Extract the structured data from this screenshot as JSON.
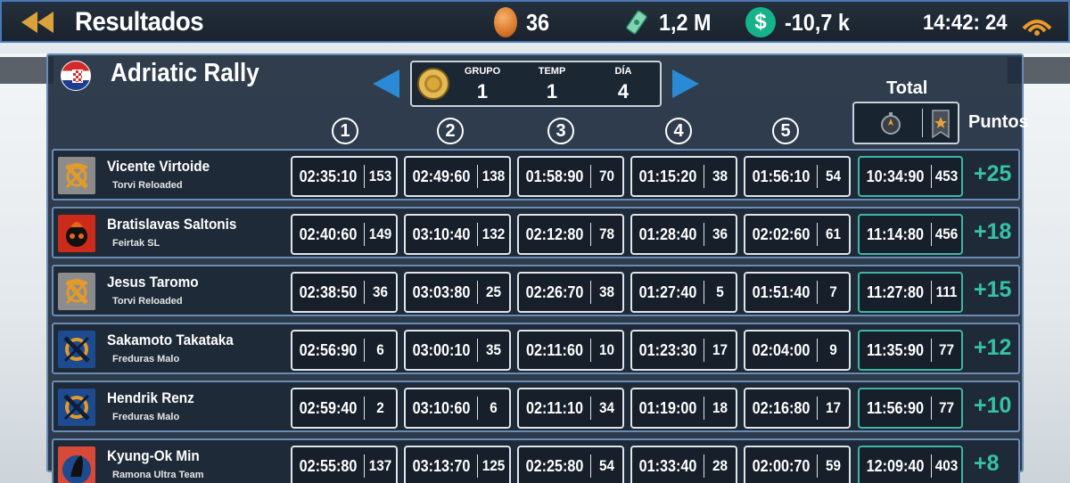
{
  "header": {
    "title": "Resultados",
    "coins": "36",
    "cash": "1,2 M",
    "balance": "-10,7 k",
    "clock": "14:42: 24",
    "colors": {
      "accent": "#4a78b8",
      "points": "#36c2a6"
    }
  },
  "event": {
    "name": "Adriatic Rally",
    "country_flag": "croatia-flag-icon",
    "info": [
      {
        "label": "GRUPO",
        "value": "1"
      },
      {
        "label": "TEMP",
        "value": "1"
      },
      {
        "label": "DÍA",
        "value": "4"
      }
    ]
  },
  "columns": {
    "stages": [
      "1",
      "2",
      "3",
      "4",
      "5"
    ],
    "total_label": "Total",
    "points_label": "Puntos"
  },
  "rows": [
    {
      "driver": "Vicente Virtoide",
      "team": "Torvi Reloaded",
      "avatar": "torvi",
      "stages": [
        [
          "02:35:10",
          "153"
        ],
        [
          "02:49:60",
          "138"
        ],
        [
          "01:58:90",
          "70"
        ],
        [
          "01:15:20",
          "38"
        ],
        [
          "01:56:10",
          "54"
        ]
      ],
      "total": [
        "10:34:90",
        "453"
      ],
      "points": "+25"
    },
    {
      "driver": "Bratislavas Saltonis",
      "team": "Feirtak SL",
      "avatar": "feirtak",
      "stages": [
        [
          "02:40:60",
          "149"
        ],
        [
          "03:10:40",
          "132"
        ],
        [
          "02:12:80",
          "78"
        ],
        [
          "01:28:40",
          "36"
        ],
        [
          "02:02:60",
          "61"
        ]
      ],
      "total": [
        "11:14:80",
        "456"
      ],
      "points": "+18"
    },
    {
      "driver": "Jesus Taromo",
      "team": "Torvi Reloaded",
      "avatar": "torvi",
      "stages": [
        [
          "02:38:50",
          "36"
        ],
        [
          "03:03:80",
          "25"
        ],
        [
          "02:26:70",
          "38"
        ],
        [
          "01:27:40",
          "5"
        ],
        [
          "01:51:40",
          "7"
        ]
      ],
      "total": [
        "11:27:80",
        "111"
      ],
      "points": "+15"
    },
    {
      "driver": "Sakamoto Takataka",
      "team": "Freduras Malo",
      "avatar": "freduras",
      "stages": [
        [
          "02:56:90",
          "6"
        ],
        [
          "03:00:10",
          "35"
        ],
        [
          "02:11:60",
          "10"
        ],
        [
          "01:23:30",
          "17"
        ],
        [
          "02:04:00",
          "9"
        ]
      ],
      "total": [
        "11:35:90",
        "77"
      ],
      "points": "+12"
    },
    {
      "driver": "Hendrik Renz",
      "team": "Freduras Malo",
      "avatar": "freduras",
      "stages": [
        [
          "02:59:40",
          "2"
        ],
        [
          "03:10:60",
          "6"
        ],
        [
          "02:11:10",
          "34"
        ],
        [
          "01:19:00",
          "18"
        ],
        [
          "02:16:80",
          "17"
        ]
      ],
      "total": [
        "11:56:90",
        "77"
      ],
      "points": "+10"
    },
    {
      "driver": "Kyung-Ok Min",
      "team": "Ramona Ultra Team",
      "avatar": "ramona",
      "stages": [
        [
          "02:55:80",
          "137"
        ],
        [
          "03:13:70",
          "125"
        ],
        [
          "02:25:80",
          "54"
        ],
        [
          "01:33:40",
          "28"
        ],
        [
          "02:00:70",
          "59"
        ]
      ],
      "total": [
        "12:09:40",
        "403"
      ],
      "points": "+8"
    }
  ]
}
